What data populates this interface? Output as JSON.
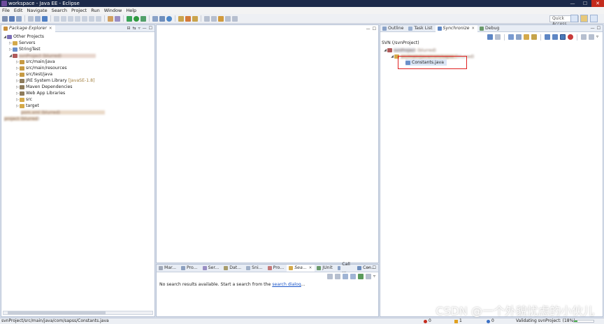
{
  "window": {
    "title": "workspace - Java EE - Eclipse"
  },
  "menu": [
    "File",
    "Edit",
    "Navigate",
    "Search",
    "Project",
    "Run",
    "Window",
    "Help"
  ],
  "quick_access": "Quick Access",
  "package_explorer": {
    "tab": "Package Explorer",
    "tree": [
      {
        "label": "Other Projects",
        "blurred": false
      },
      {
        "label": "Servers",
        "blurred": false
      },
      {
        "label": "StringTest",
        "blurred": false
      },
      {
        "label": "svnProject (blurred)",
        "blurred": true
      },
      {
        "label": "src/main/java",
        "blurred": false
      },
      {
        "label": "src/main/resources",
        "blurred": false
      },
      {
        "label": "src/test/java",
        "blurred": false
      },
      {
        "label": "JRE System Library",
        "suffix": "[JavaSE-1.8]",
        "blurred": false
      },
      {
        "label": "Maven Dependencies",
        "blurred": false
      },
      {
        "label": "Web App Libraries",
        "blurred": false
      },
      {
        "label": "src",
        "blurred": false
      },
      {
        "label": "target",
        "blurred": false
      },
      {
        "label": "pom.xml (blurred)",
        "blurred": true
      },
      {
        "label": "project (blurred)",
        "blurred": true
      }
    ]
  },
  "right_panel": {
    "tabs": [
      "Outline",
      "Task List",
      "Synchronize",
      "Debug"
    ],
    "active_tab": "Synchronize",
    "sync_title": "SVN (/svnProject)",
    "tree": [
      {
        "label": "svnProject (blurred)",
        "blurred": true
      },
      {
        "label": "src/main/java/com/sapss (blurred)",
        "blurred": true
      },
      {
        "label": "Constants.java",
        "blurred": false
      }
    ]
  },
  "bottom_panel": {
    "tabs": [
      "Mar...",
      "Pro...",
      "Ser...",
      "Dat...",
      "Sni...",
      "Pro...",
      "Sea...",
      "JUnit",
      "Call ...",
      "Con..."
    ],
    "active_tab": "Sea...",
    "message": "No search results available. Start a search from the ",
    "link": "search dialog",
    "link_suffix": "..."
  },
  "status_bar": {
    "path": "svnProject/src/main/java/com/sapss/Constants.java",
    "errors": "0",
    "warnings": "1",
    "infos": "0",
    "progress": "Validating svnProject: (18%)"
  },
  "watermark": "CSDN @一个外貌忧虑的小伙儿",
  "colors": {
    "accent": "#2b4f8f",
    "highlight_box": "#e02020",
    "link": "#1a55c9"
  }
}
